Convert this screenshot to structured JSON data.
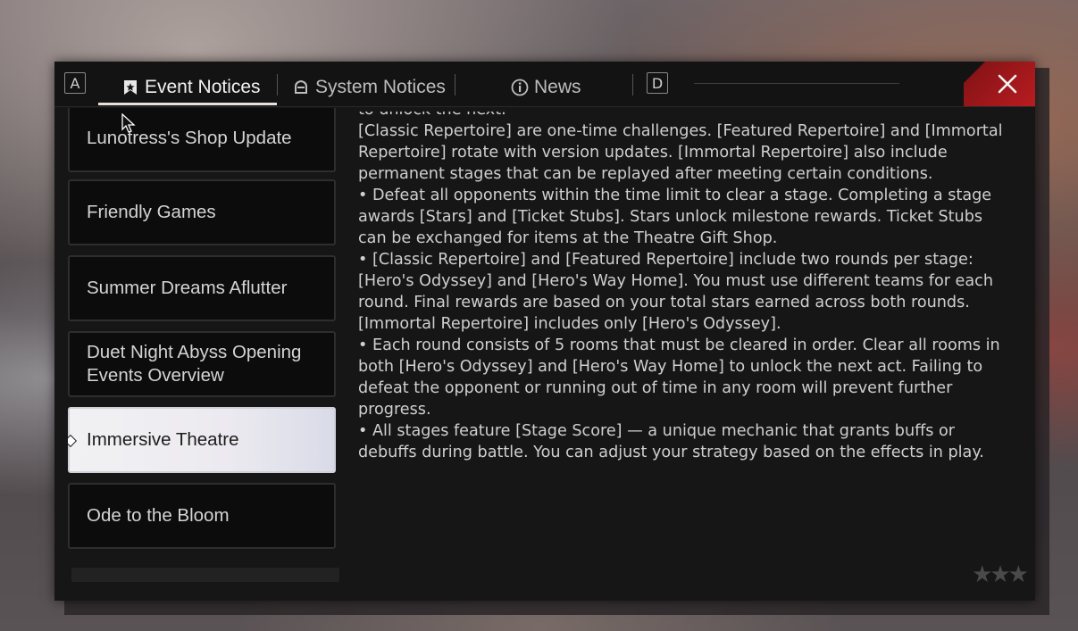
{
  "header": {
    "key_left": "A",
    "key_right": "D",
    "tabs": [
      {
        "label": "Event Notices",
        "icon": "event-bookmark-icon"
      },
      {
        "label": "System Notices",
        "icon": "system-bell-icon"
      },
      {
        "label": "News",
        "icon": "info-icon"
      }
    ],
    "close_icon": "close-icon"
  },
  "sidebar": {
    "items": [
      {
        "label": "Lunotress's Shop Update"
      },
      {
        "label": "Friendly Games"
      },
      {
        "label": "Summer Dreams Aflutter"
      },
      {
        "label": "Duet Night Abyss Opening Events Overview"
      },
      {
        "label": "Immersive Theatre",
        "selected": true
      },
      {
        "label": "Ode to the Bloom"
      }
    ]
  },
  "content": {
    "paragraphs": [
      "to unlock the next.",
      "[Classic Repertoire] are one-time challenges. [Featured Repertoire] and [Immortal Repertoire] rotate with version updates. [Immortal Repertoire] also include permanent stages that can be replayed after meeting certain conditions.",
      "• Defeat all opponents within the time limit to clear a stage. Completing a stage awards [Stars] and [Ticket Stubs]. Stars unlock milestone rewards. Ticket Stubs can be exchanged for items at the Theatre Gift Shop.",
      "• [Classic Repertoire] and [Featured Repertoire] include two rounds per stage: [Hero's Odyssey] and [Hero's Way Home]. You must use different teams for each round. Final rewards are based on your total stars earned across both rounds. [Immortal Repertoire] includes only [Hero's Odyssey].",
      "• Each round consists of 5 rooms that must be cleared in order. Clear all rooms in both [Hero's Odyssey] and [Hero's Way Home] to unlock the next act. Failing to defeat the opponent or running out of time in any room will prevent further progress.",
      "• All stages feature [Stage Score] — a unique mechanic that grants buffs or debuffs during battle. You can adjust your strategy based on the effects in play."
    ]
  },
  "colors": {
    "accent_close": "#b81c20",
    "panel_bg": "#171617",
    "selected_item_bg": "#f1f1f3",
    "text": "#cfcfcf"
  }
}
